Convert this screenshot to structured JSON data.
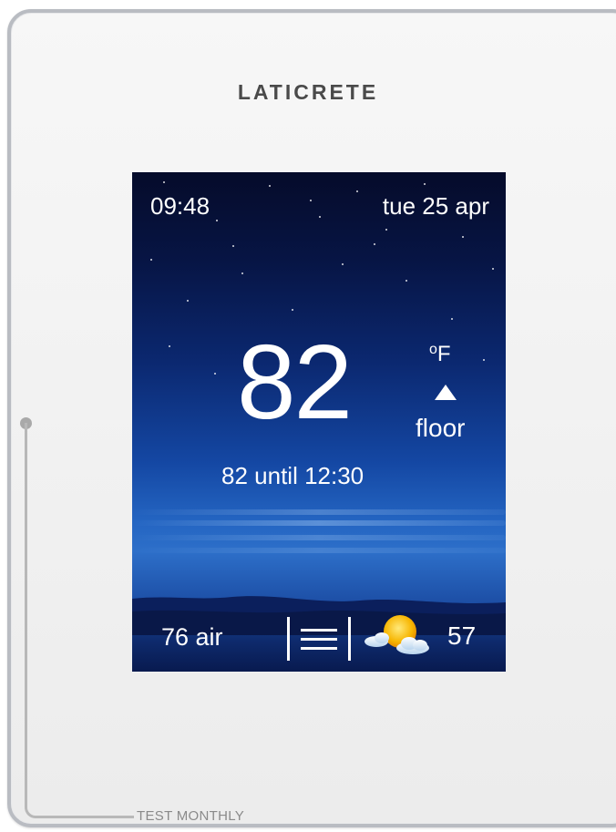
{
  "device": {
    "brand": "LATICRETE",
    "test_label": "TEST MONTHLY"
  },
  "screen": {
    "time": "09:48",
    "date": "tue 25 apr",
    "setpoint": "82",
    "unit_degree": "o",
    "unit_letter": "F",
    "mode": "floor",
    "schedule": "82 until 12:30",
    "air_reading": "76 air",
    "outdoor_temp": "57",
    "weather_icon": "partly-cloudy-sun-icon",
    "menu_icon": "hamburger-menu-icon"
  },
  "colors": {
    "screen_top": "#050b2a",
    "screen_mid": "#1447a3",
    "text": "#ffffff",
    "bezel": "#b9bcc2"
  }
}
